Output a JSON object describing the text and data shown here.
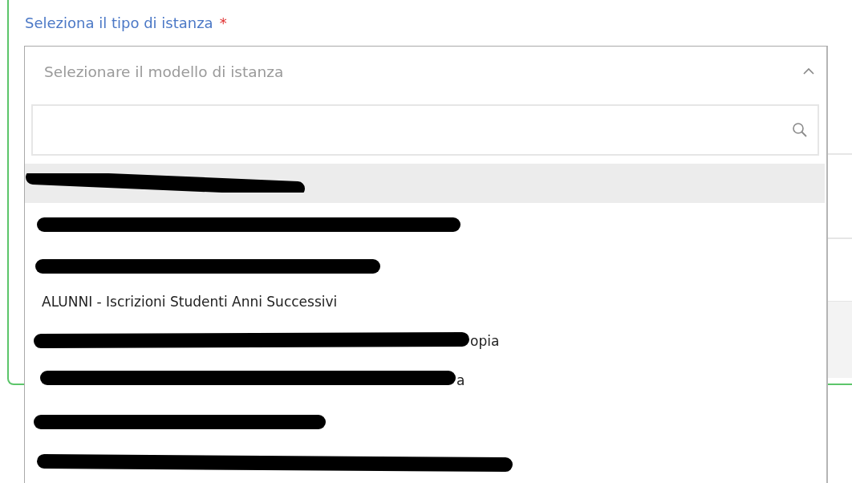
{
  "field": {
    "label": "Seleziona il tipo di istanza",
    "required_mark": "*",
    "placeholder": "Selezionare il modello di istanza",
    "expanded": true
  },
  "options": [
    {
      "kind": "redacted",
      "selected": true
    },
    {
      "kind": "redacted",
      "selected": false
    },
    {
      "kind": "redacted",
      "selected": false
    },
    {
      "kind": "text",
      "text": "ALUNNI - Iscrizioni Studenti Anni Successivi",
      "selected": false
    },
    {
      "kind": "redacted",
      "tail": "opia",
      "selected": false
    },
    {
      "kind": "redacted",
      "tail": "a",
      "selected": false
    },
    {
      "kind": "redacted",
      "selected": false
    },
    {
      "kind": "redacted",
      "selected": false
    }
  ]
}
